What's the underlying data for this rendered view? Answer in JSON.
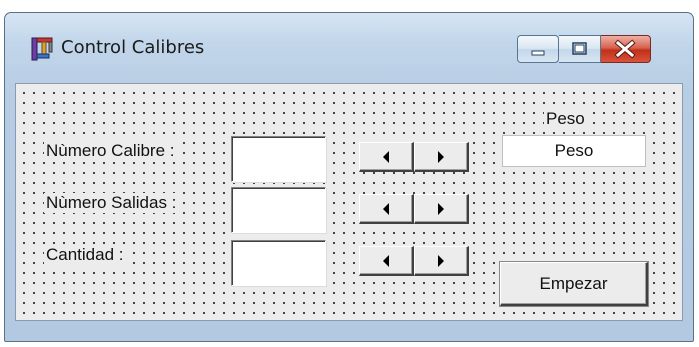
{
  "window": {
    "title": "Control Calibres",
    "icon": "calipers-app-icon"
  },
  "caption_buttons": {
    "minimize_icon": "minimize-icon",
    "maximize_icon": "maximize-icon",
    "close_icon": "close-icon",
    "close_color": "#c93a22"
  },
  "form": {
    "rows": [
      {
        "label": "Nùmero Calibre :",
        "value": ""
      },
      {
        "label": "Nùmero Salidas :",
        "value": ""
      },
      {
        "label": "Cantidad :",
        "value": ""
      }
    ],
    "peso_label": "Peso",
    "peso_value": "Peso",
    "start_button": "Empezar"
  }
}
